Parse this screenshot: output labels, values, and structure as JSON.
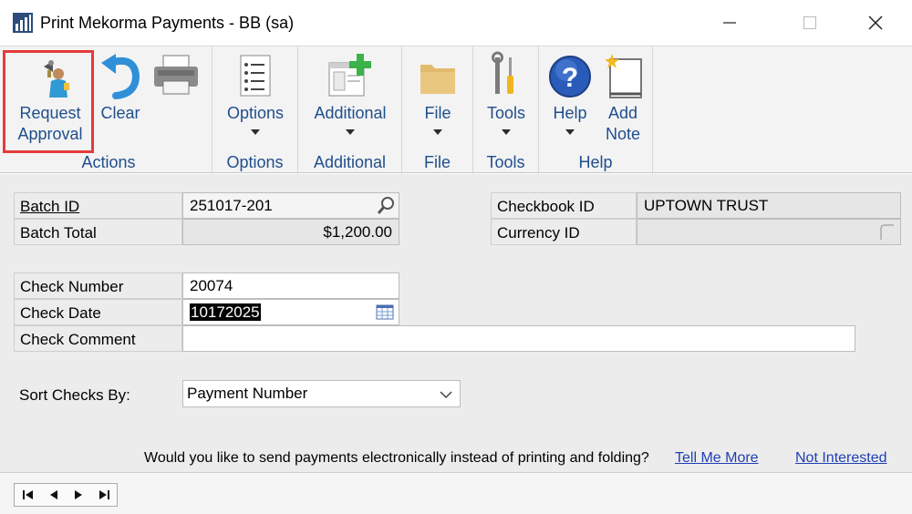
{
  "window": {
    "title": "Print Mekorma Payments  -  BB (sa)",
    "minimize_glyph": "—",
    "maximize_glyph": "☐",
    "close_glyph": "✕"
  },
  "ribbon": {
    "actions": {
      "group_label": "Actions",
      "request_approval_line1": "Request",
      "request_approval_line2": "Approval",
      "clear_label": "Clear"
    },
    "options": {
      "button_label": "Options",
      "group_label": "Options"
    },
    "additional": {
      "button_label": "Additional",
      "group_label": "Additional"
    },
    "file": {
      "button_label": "File",
      "group_label": "File"
    },
    "tools": {
      "button_label": "Tools",
      "group_label": "Tools"
    },
    "help": {
      "help_label": "Help",
      "add_note_line1": "Add",
      "add_note_line2": "Note",
      "group_label": "Help"
    }
  },
  "form": {
    "batch_id_label": "Batch ID",
    "batch_id_value": "251017-201",
    "batch_total_label": "Batch Total",
    "batch_total_value": "$1,200.00",
    "checkbook_id_label": "Checkbook ID",
    "checkbook_id_value": "UPTOWN TRUST",
    "currency_id_label": "Currency ID",
    "currency_id_value": "",
    "check_number_label": "Check Number",
    "check_number_value": "20074",
    "check_date_label": "Check Date",
    "check_date_value": "10172025",
    "check_comment_label": "Check Comment",
    "check_comment_value": "",
    "sort_label": "Sort Checks By:",
    "sort_value": "Payment Number"
  },
  "promo": {
    "message": "Would you like to send payments electronically instead of printing and folding?",
    "tell_me_more": "Tell Me More",
    "not_interested": "Not Interested"
  },
  "colors": {
    "ribbon_text": "#1f4e8c",
    "highlight": "#e43b3b",
    "link": "#1f3fb5"
  }
}
